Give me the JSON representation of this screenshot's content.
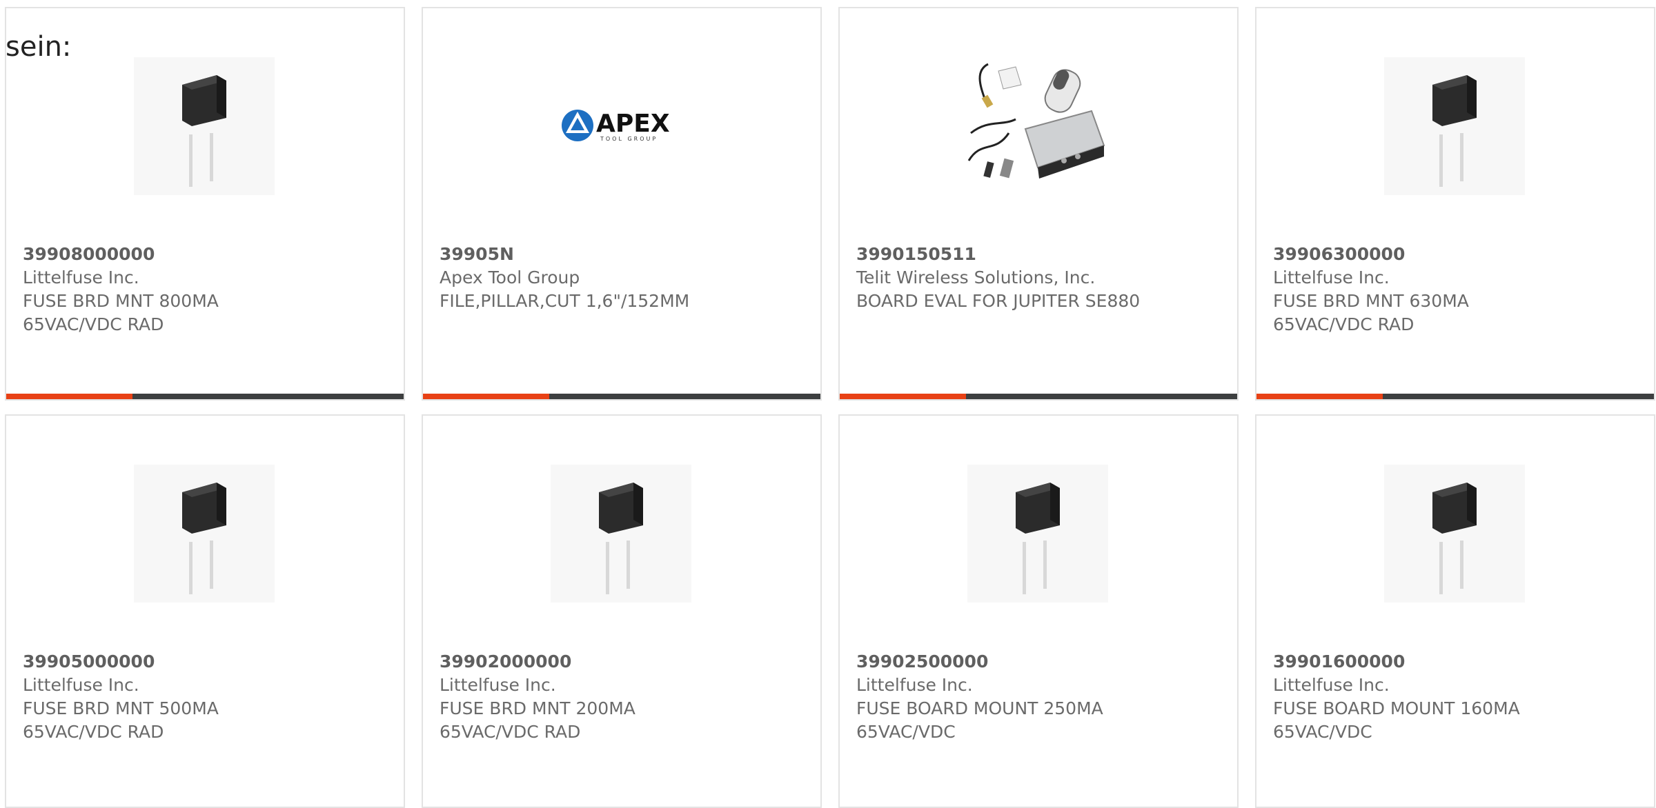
{
  "intro_text": "sein:",
  "colors": {
    "accent_bar": "#e84115",
    "dark_bar": "#3d3f40",
    "card_border": "#e3e3e3",
    "text": "#6a6a6a"
  },
  "products": [
    {
      "part_number": "39908000000",
      "manufacturer": "Littelfuse Inc.",
      "description_line1": "FUSE BRD MNT 800MA",
      "description_line2": "65VAC/VDC RAD",
      "image": "fuse-icon",
      "accent_bar": true
    },
    {
      "part_number": "39905N",
      "manufacturer": "Apex Tool Group",
      "description_line1": "FILE,PILLAR,CUT 1,6\"/152MM",
      "description_line2": "",
      "image": "apex-logo",
      "logo_text": "APEX",
      "logo_subtext": "TOOL GROUP",
      "accent_bar": true
    },
    {
      "part_number": "3990150511",
      "manufacturer": "Telit Wireless Solutions, Inc.",
      "description_line1": "BOARD EVAL FOR JUPITER SE880",
      "description_line2": "",
      "image": "eval-kit-icon",
      "accent_bar": true
    },
    {
      "part_number": "39906300000",
      "manufacturer": "Littelfuse Inc.",
      "description_line1": "FUSE BRD MNT 630MA",
      "description_line2": "65VAC/VDC RAD",
      "image": "fuse-icon",
      "accent_bar": true
    },
    {
      "part_number": "39905000000",
      "manufacturer": "Littelfuse Inc.",
      "description_line1": "FUSE BRD MNT 500MA",
      "description_line2": "65VAC/VDC RAD",
      "image": "fuse-icon",
      "accent_bar": false
    },
    {
      "part_number": "39902000000",
      "manufacturer": "Littelfuse Inc.",
      "description_line1": "FUSE BRD MNT 200MA",
      "description_line2": "65VAC/VDC RAD",
      "image": "fuse-icon",
      "accent_bar": false
    },
    {
      "part_number": "39902500000",
      "manufacturer": "Littelfuse Inc.",
      "description_line1": "FUSE BOARD MOUNT 250MA",
      "description_line2": "65VAC/VDC",
      "image": "fuse-icon",
      "accent_bar": false
    },
    {
      "part_number": "39901600000",
      "manufacturer": "Littelfuse Inc.",
      "description_line1": "FUSE BOARD MOUNT 160MA",
      "description_line2": "65VAC/VDC",
      "image": "fuse-icon",
      "accent_bar": false
    }
  ]
}
